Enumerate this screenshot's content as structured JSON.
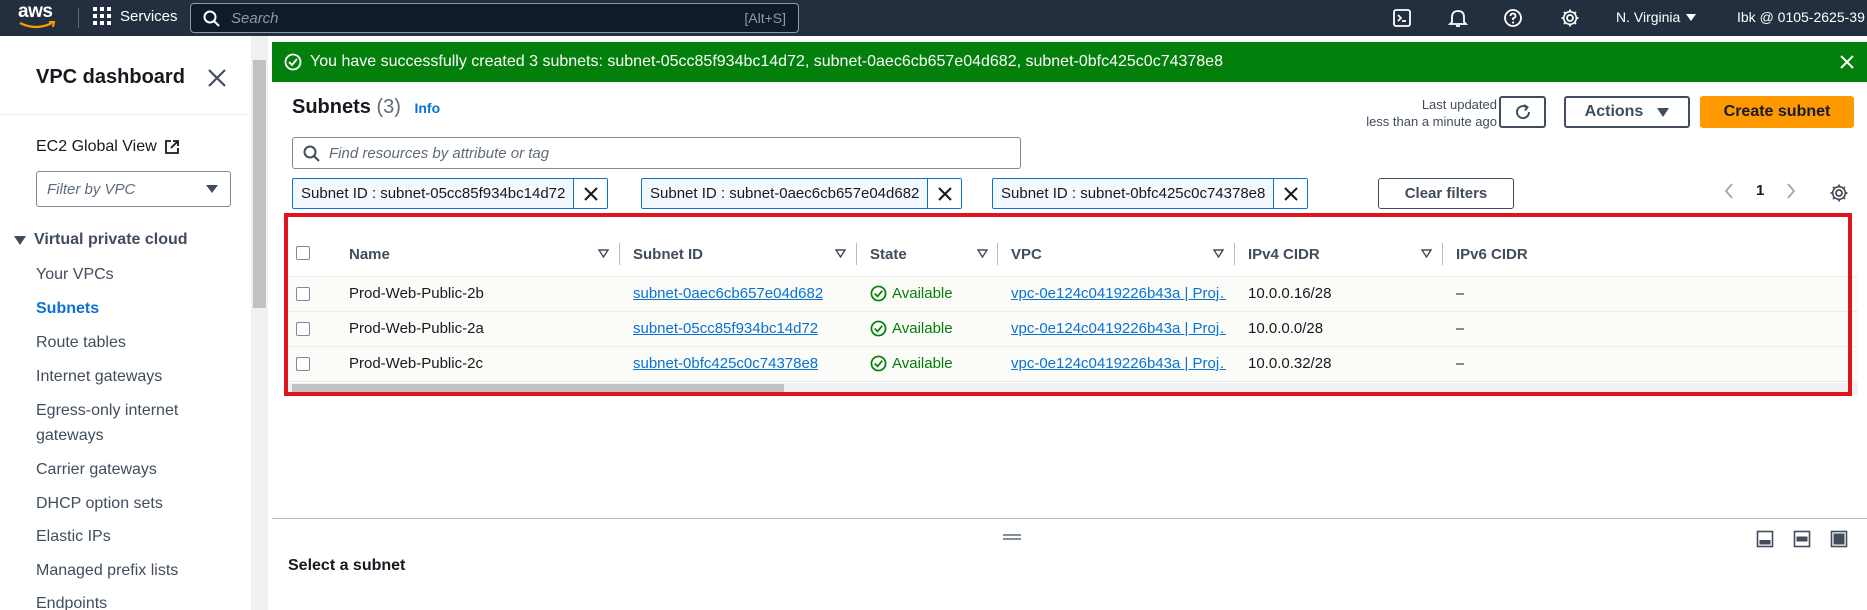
{
  "topnav": {
    "logo_text": "aws",
    "services_label": "Services",
    "search_placeholder": "Search",
    "search_shortcut": "[Alt+S]",
    "region": "N. Virginia",
    "account": "Ibk @ 0105-2625-39"
  },
  "sidebar": {
    "title": "VPC dashboard",
    "ec2_global_view": "EC2 Global View",
    "filter_placeholder": "Filter by VPC",
    "section": "Virtual private cloud",
    "items": [
      {
        "label": "Your VPCs",
        "active": false
      },
      {
        "label": "Subnets",
        "active": true
      },
      {
        "label": "Route tables",
        "active": false
      },
      {
        "label": "Internet gateways",
        "active": false
      },
      {
        "label": "Egress-only internet gateways",
        "active": false
      },
      {
        "label": "Carrier gateways",
        "active": false
      },
      {
        "label": "DHCP option sets",
        "active": false
      },
      {
        "label": "Elastic IPs",
        "active": false
      },
      {
        "label": "Managed prefix lists",
        "active": false
      },
      {
        "label": "Endpoints",
        "active": false
      }
    ]
  },
  "flash": {
    "message": "You have successfully created 3 subnets: subnet-05cc85f934bc14d72, subnet-0aec6cb657e04d682, subnet-0bfc425c0c74378e8"
  },
  "header": {
    "title": "Subnets",
    "count": "(3)",
    "info_link": "Info",
    "last_updated_label": "Last updated",
    "last_updated_value": "less than a minute ago",
    "actions_label": "Actions",
    "create_label": "Create subnet"
  },
  "filter": {
    "placeholder": "Find resources by attribute or tag",
    "tokens": [
      "Subnet ID : subnet-05cc85f934bc14d72",
      "Subnet ID : subnet-0aec6cb657e04d682",
      "Subnet ID : subnet-0bfc425c0c74378e8"
    ],
    "clear_label": "Clear filters"
  },
  "pagination": {
    "current_page": "1"
  },
  "table": {
    "columns": [
      "Name",
      "Subnet ID",
      "State",
      "VPC",
      "IPv4 CIDR",
      "IPv6 CIDR"
    ],
    "rows": [
      {
        "name": "Prod-Web-Public-2b",
        "subnet_id": "subnet-0aec6cb657e04d682",
        "state": "Available",
        "vpc": "vpc-0e124c0419226b43a | Proj…",
        "ipv4": "10.0.0.16/28",
        "ipv6": "–"
      },
      {
        "name": "Prod-Web-Public-2a",
        "subnet_id": "subnet-05cc85f934bc14d72",
        "state": "Available",
        "vpc": "vpc-0e124c0419226b43a | Proj…",
        "ipv4": "10.0.0.0/28",
        "ipv6": "–"
      },
      {
        "name": "Prod-Web-Public-2c",
        "subnet_id": "subnet-0bfc425c0c74378e8",
        "state": "Available",
        "vpc": "vpc-0e124c0419226b43a | Proj…",
        "ipv4": "10.0.0.32/28",
        "ipv6": "–"
      }
    ]
  },
  "split_panel": {
    "empty_label": "Select a subnet"
  },
  "colors": {
    "nav_bg": "#232f3e",
    "success_green": "#037f0c",
    "link_blue": "#0972d3",
    "primary_orange": "#ff9900",
    "highlight_red": "#e0141f"
  },
  "icons": [
    "grid-icon",
    "search-icon",
    "cloudshell-icon",
    "bell-icon",
    "help-icon",
    "gear-icon",
    "close-icon",
    "external-link-icon",
    "caret-down-icon",
    "success-icon",
    "refresh-icon",
    "sort-icon",
    "chevron-left-icon",
    "chevron-right-icon",
    "drag-handle-icon",
    "panel-position-icon"
  ]
}
